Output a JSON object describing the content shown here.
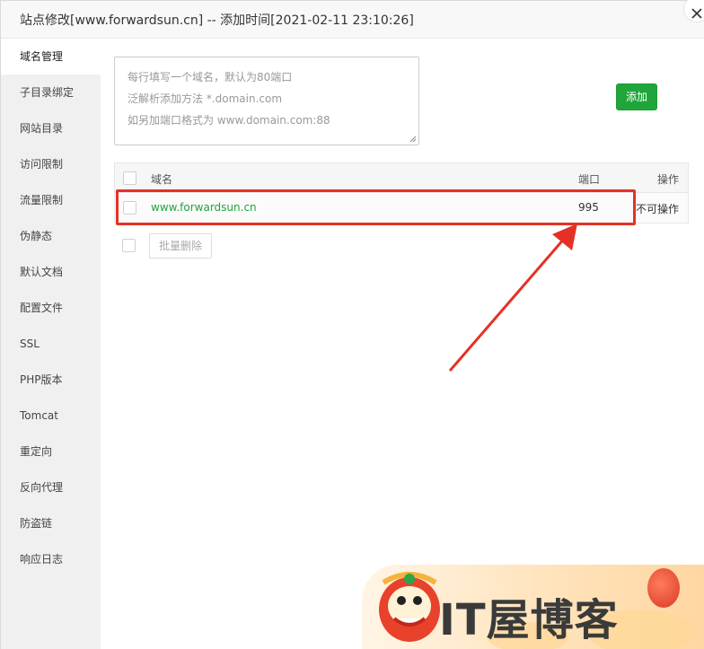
{
  "window": {
    "title": "站点修改[www.forwardsun.cn] -- 添加时间[2021-02-11 23:10:26]"
  },
  "sidebar": {
    "items": [
      {
        "label": "域名管理",
        "active": true
      },
      {
        "label": "子目录绑定"
      },
      {
        "label": "网站目录"
      },
      {
        "label": "访问限制"
      },
      {
        "label": "流量限制"
      },
      {
        "label": "伪静态"
      },
      {
        "label": "默认文档"
      },
      {
        "label": "配置文件"
      },
      {
        "label": "SSL"
      },
      {
        "label": "PHP版本"
      },
      {
        "label": "Tomcat"
      },
      {
        "label": "重定向"
      },
      {
        "label": "反向代理"
      },
      {
        "label": "防盗链"
      },
      {
        "label": "响应日志"
      }
    ]
  },
  "domain_input": {
    "placeholder_lines": [
      "每行填写一个域名，默认为80端口",
      "泛解析添加方法 *.domain.com",
      "如另加端口格式为 www.domain.com:88"
    ],
    "add_label": "添加"
  },
  "table": {
    "headers": {
      "domain": "域名",
      "port": "端口",
      "action": "操作"
    },
    "rows": [
      {
        "domain": "www.forwardsun.cn",
        "port": "995",
        "action": "不可操作"
      }
    ]
  },
  "batch_delete_label": "批量删除",
  "watermark": {
    "text": "IT屋博客"
  },
  "colors": {
    "accent": "#20a53a",
    "highlight": "#e53125"
  }
}
